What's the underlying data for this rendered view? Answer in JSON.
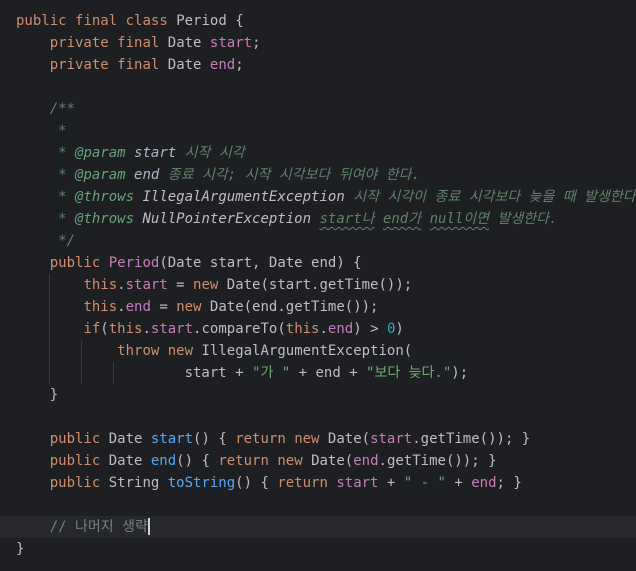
{
  "code": {
    "l1": {
      "kw1": "public",
      "kw2": "final",
      "kw3": "class",
      "cls": "Period",
      "p": " {"
    },
    "l2": {
      "kw1": "private",
      "kw2": "final",
      "type": "Date",
      "field": "start",
      "p": ";"
    },
    "l3": {
      "kw1": "private",
      "kw2": "final",
      "type": "Date",
      "field": "end",
      "p": ";"
    },
    "l5": {
      "t": "/**"
    },
    "l6": {
      "t": "*"
    },
    "l7": {
      "star": "* ",
      "tag": "@param",
      "name": "start",
      "desc": "시작 시각"
    },
    "l8": {
      "star": "* ",
      "tag": "@param",
      "name": "end",
      "desc": "종료 시각; 시작 시각보다 뒤여야 한다."
    },
    "l9": {
      "star": "* ",
      "tag": "@throws",
      "name": "IllegalArgumentException",
      "desc": "시작 시각이 종료 시각보다 늦을 때 발생한다."
    },
    "l10": {
      "star": "* ",
      "tag": "@throws",
      "name": "NullPointerException",
      "u1": "start나",
      "u2": "end가",
      "u3": "null이면",
      "desc": "발생한다."
    },
    "l11": {
      "t": "*/"
    },
    "l12": {
      "kw": "public",
      "name": "Period",
      "sig": "(Date start, Date end) {"
    },
    "l13": {
      "kw": "this",
      "field": "start",
      "eq": " = ",
      "kwnew": "new",
      "rest": " Date(start.getTime());"
    },
    "l14": {
      "kw": "this",
      "field": "end",
      "eq": " = ",
      "kwnew": "new",
      "rest": " Date(end.getTime());"
    },
    "l15": {
      "kwif": "if",
      "p1": "(",
      "kw": "this",
      "field": "start",
      "call": ".compareTo(",
      "kw2": "this",
      "field2": "end",
      "p2": ") > ",
      "num": "0",
      "p3": ")"
    },
    "l16": {
      "kwthrow": "throw",
      "kwnew": "new",
      "rest": " IllegalArgumentException("
    },
    "l17": {
      "a": "start + ",
      "s1": "\"가 \"",
      "b": " + end + ",
      "s2": "\"보다 늦다.\"",
      "c": ");"
    },
    "l18": {
      "t": "}"
    },
    "l20": {
      "kw": "public",
      "type": " Date ",
      "fn": "start",
      "a": "() { ",
      "kwret": "return",
      "kwnew": "new",
      "b": " Date(",
      "field": "start",
      "c": ".getTime()); }"
    },
    "l21": {
      "kw": "public",
      "type": " Date ",
      "fn": "end",
      "a": "() { ",
      "kwret": "return",
      "kwnew": "new",
      "b": " Date(",
      "field": "end",
      "c": ".getTime()); }"
    },
    "l22": {
      "kw": "public",
      "type": " String ",
      "fn": "toString",
      "a": "() { ",
      "kwret": "return",
      "field1": "start",
      "b": " + ",
      "s": "\" - \"",
      "c": " + ",
      "field2": "end",
      "d": "; }"
    },
    "l24": {
      "t": "// 나머지 생략"
    },
    "l25": {
      "t": "}"
    }
  }
}
